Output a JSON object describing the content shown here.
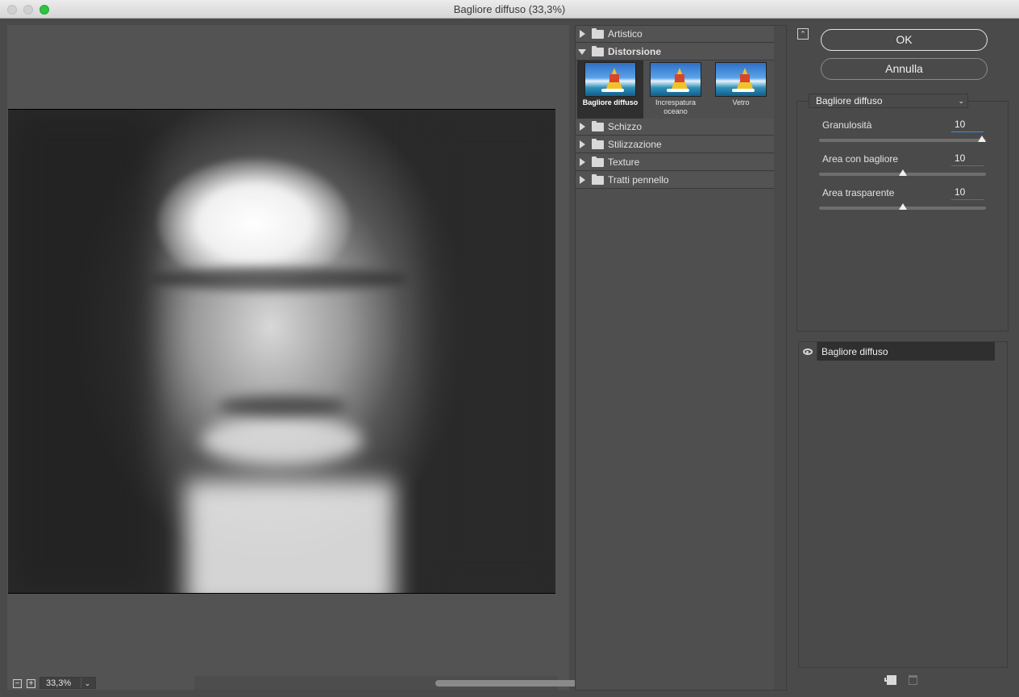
{
  "window": {
    "title": "Bagliore diffuso (33,3%)"
  },
  "preview": {
    "zoom": "33,3%",
    "zoom_out_icon": "minus-icon",
    "zoom_in_icon": "plus-icon"
  },
  "gallery": {
    "categories": [
      {
        "label": "Artistico",
        "expanded": false
      },
      {
        "label": "Distorsione",
        "expanded": true
      },
      {
        "label": "Schizzo",
        "expanded": false
      },
      {
        "label": "Stilizzazione",
        "expanded": false
      },
      {
        "label": "Texture",
        "expanded": false
      },
      {
        "label": "Tratti pennello",
        "expanded": false
      }
    ],
    "thumbs": [
      {
        "label": "Bagliore diffuso",
        "selected": true
      },
      {
        "label": "Increspatura oceano",
        "selected": false
      },
      {
        "label": "Vetro",
        "selected": false
      }
    ]
  },
  "buttons": {
    "ok": "OK",
    "cancel": "Annulla"
  },
  "filter_select": "Bagliore diffuso",
  "params": [
    {
      "label": "Granulosità",
      "value": "10",
      "slider": 1.0
    },
    {
      "label": "Area con bagliore",
      "value": "10",
      "slider": 0.5
    },
    {
      "label": "Area trasparente",
      "value": "10",
      "slider": 0.5
    }
  ],
  "layers": [
    {
      "name": "Bagliore diffuso",
      "visible": true
    }
  ]
}
